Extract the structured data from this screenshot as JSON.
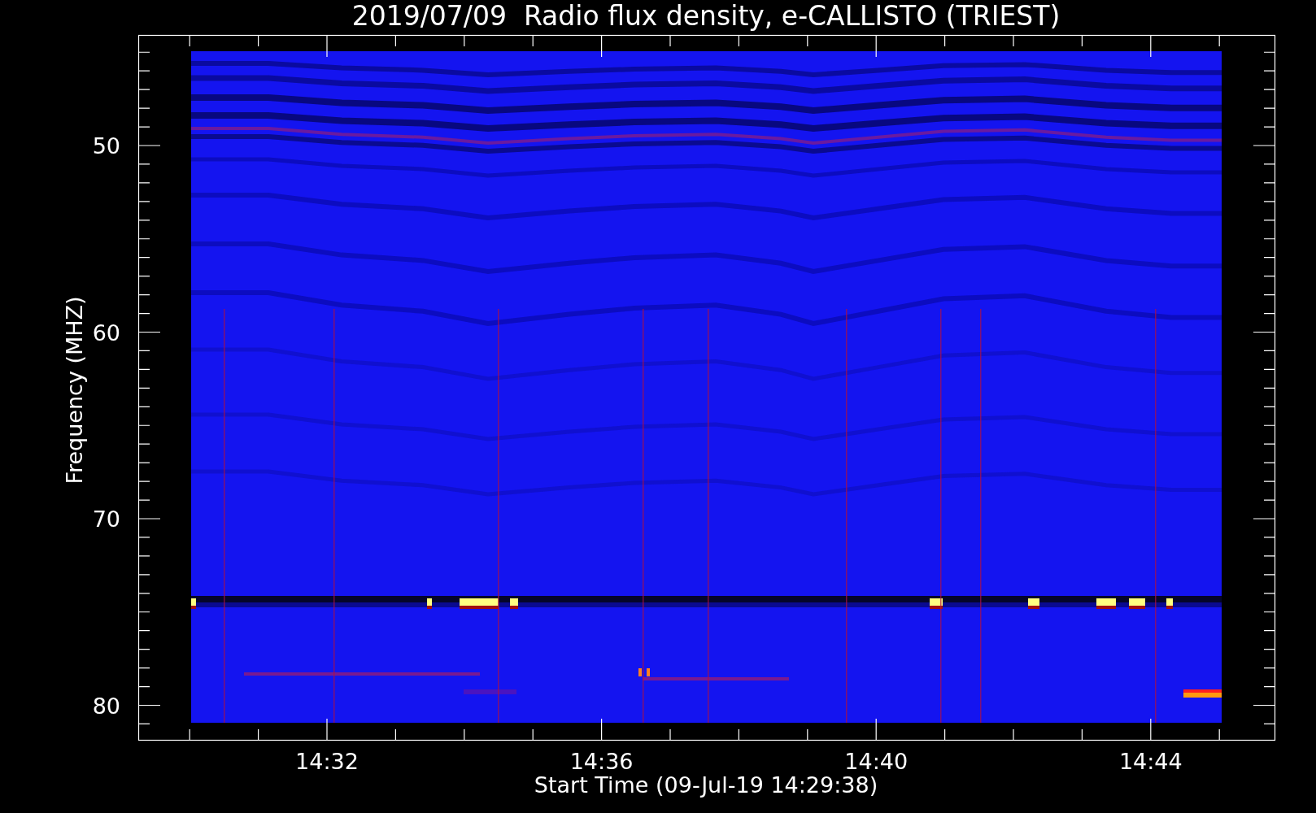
{
  "title": "2019/07/09  Radio flux density, e-CALLISTO (TRIEST)",
  "y_axis": {
    "label": "Frequency (MHZ)",
    "ticks": [
      "50",
      "60",
      "70",
      "80"
    ]
  },
  "x_axis": {
    "label": "Start Time (09-Jul-19 14:29:38)",
    "ticks": [
      "14:32",
      "14:36",
      "14:40",
      "14:44"
    ]
  }
}
